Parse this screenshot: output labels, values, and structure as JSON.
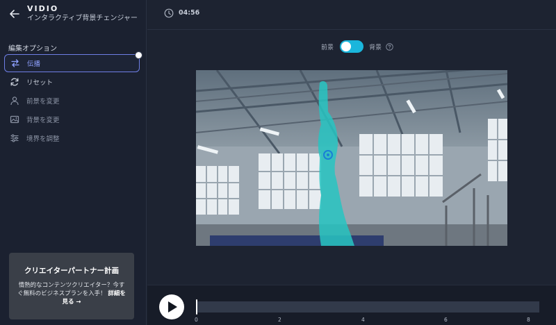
{
  "header": {
    "brand": "VIDIO",
    "subtitle": "インタラクティブ背景チェンジャー",
    "time": "04:56"
  },
  "sidebar": {
    "section_title": "編集オプション",
    "items": [
      {
        "label": "伝播",
        "icon": "swap-arrows-icon",
        "active": true
      },
      {
        "label": "リセット",
        "icon": "refresh-icon"
      },
      {
        "label": "前景を変更",
        "icon": "person-icon"
      },
      {
        "label": "背景を変更",
        "icon": "image-icon"
      },
      {
        "label": "境界を調整",
        "icon": "sliders-icon"
      }
    ]
  },
  "toggle": {
    "left_label": "前景",
    "right_label": "背景",
    "state": "on"
  },
  "promo": {
    "title": "クリエイターパートナー計画",
    "body": "情熱的なコンテンツクリエイター？今すぐ無料のビジネスプランを入手！",
    "link": "詳細を見る →"
  },
  "timeline": {
    "ticks": [
      "0",
      "2",
      "4",
      "6",
      "8"
    ],
    "position": 0
  },
  "colors": {
    "accent": "#1ab6dc",
    "active_item": "#6f7fe6",
    "mask": "#27c4c2"
  }
}
